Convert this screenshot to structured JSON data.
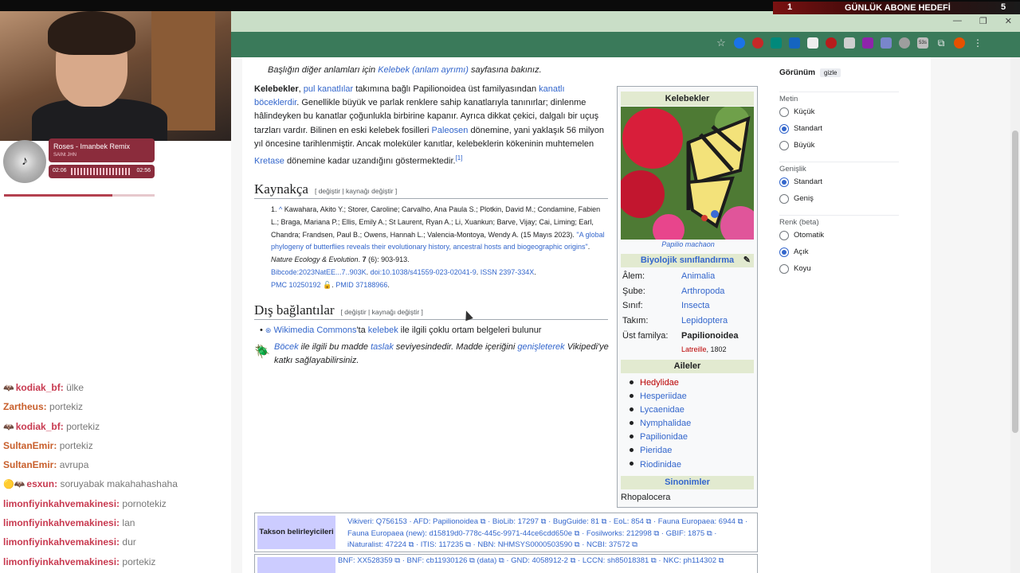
{
  "stream": {
    "sub_goal_count": "1",
    "sub_goal_label": "GÜNLÜK ABONE HEDEFİ",
    "sub_goal_target": "5",
    "music": {
      "title": "Roses - Imanbek Remix",
      "artist": "SAINt JHN",
      "time_current": "02:06",
      "time_total": "02:56",
      "progress": 0.72
    },
    "chat": [
      {
        "icon": "batman-badge",
        "user": "kodiak_bf:",
        "msg": "ülke",
        "color": "pink"
      },
      {
        "icon": "",
        "user": "Zartheus:",
        "msg": "portekiz",
        "color": "orange"
      },
      {
        "icon": "batman-badge",
        "user": "kodiak_bf:",
        "msg": "portekiz",
        "color": "pink"
      },
      {
        "icon": "",
        "user": "SultanEmir:",
        "msg": "portekiz",
        "color": "orange"
      },
      {
        "icon": "",
        "user": "SultanEmir:",
        "msg": "avrupa",
        "color": "orange"
      },
      {
        "icon": "sub-badge",
        "user": "esxun:",
        "msg": "soruyabak makahahashaha",
        "color": "pink"
      },
      {
        "icon": "",
        "user": "limonfiyinkahvemakinesi:",
        "msg": "pornotekiz",
        "color": "pink"
      },
      {
        "icon": "",
        "user": "limonfiyinkahvemakinesi:",
        "msg": "lan",
        "color": "pink"
      },
      {
        "icon": "",
        "user": "limonfiyinkahvemakinesi:",
        "msg": "dur",
        "color": "pink"
      },
      {
        "icon": "",
        "user": "limonfiyinkahvemakinesi:",
        "msg": "portekiz",
        "color": "pink"
      }
    ]
  },
  "browser": {
    "toolbar_icons": [
      "star-icon",
      "ext-icon-1",
      "ext-icon-2",
      "ext-icon-3",
      "ext-icon-4",
      "ext-icon-5",
      "ext-icon-6",
      "ext-icon-7",
      "ext-icon-8",
      "ext-icon-9",
      "ext-icon-10",
      "ext-icon-11",
      "puzzle-icon",
      "profile-icon",
      "menu-icon"
    ],
    "badge_text": "53s"
  },
  "article": {
    "hatnote_prefix": "Başlığın diğer anlamları için ",
    "hatnote_link": "Kelebek (anlam ayrımı)",
    "hatnote_suffix": " sayfasına bakınız.",
    "lead": {
      "bold": "Kelebekler",
      "t1": ", ",
      "l1": "pul kanatlılar",
      "t2": " takımına bağlı Papilionoidea üst familyasından ",
      "l2": "kanatlı böceklerdir",
      "t3": ". Genellikle büyük ve parlak renklere sahip kanatlarıyla tanınırlar; dinlenme hâlindeyken bu kanatlar çoğunlukla birbirine kapanır. Ayrıca dikkat çekici, dalgalı bir uçuş tarzları vardır. Bilinen en eski kelebek fosilleri ",
      "l3": "Paleosen",
      "t4": " dönemine, yani yaklaşık 56 milyon yıl öncesine tarihlenmiştir. Ancak moleküler kanıtlar, kelebeklerin kökeninin muhtemelen ",
      "l4": "Kretase",
      "t5": " dönemine kadar uzandığını göstermektedir.",
      "ref": "[1]"
    },
    "refs_heading": "Kaynakça",
    "refs_edit": "[ değiştir | kaynağı değiştir ]",
    "ref1": {
      "num": "1.",
      "caret": "^",
      "authors": "Kawahara, Akito Y.; Storer, Caroline; Carvalho, Ana Paula S.; Plotkin, David M.; Condamine, Fabien L.; Braga, Mariana P.; Ellis, Emily A.; St Laurent, Ryan A.; Li, Xuankun; Barve, Vijay; Cai, Liming; Earl, Chandra; Frandsen, Paul B.; Owens, Hannah L.; Valencia-Montoya, Wendy A. (15 Mayıs 2023). ",
      "title": "\"A global phylogeny of butterflies reveals their evolutionary history, ancestral hosts and biogeographic origins\"",
      "journal": "Nature Ecology & Evolution",
      "vol": "7",
      "pages": "(6): 903-913.",
      "bibcode": "Bibcode:2023NatEE...7..903K",
      "doi": "doi:10.1038/s41559-023-02041-9",
      "issn": "ISSN 2397-334X",
      "pmc": "PMC 10250192",
      "pmid": "PMID 37188966"
    },
    "ext_heading": "Dış bağlantılar",
    "ext_edit": "[ değiştir | kaynağı değiştir ]",
    "ext_item": {
      "l1": "Wikimedia Commons",
      "t1": "'ta ",
      "l2": "kelebek",
      "t2": " ile ilgili çoklu ortam belgeleri bulunur"
    },
    "stub": {
      "l1": "Böcek",
      "t1": " ile ilgili bu madde ",
      "l2": "taslak",
      "t2": " seviyesindedir. Madde içeriğini ",
      "l3": "genişleterek",
      "t3": " Vikipedi'ye katkı sağlayabilirsiniz."
    }
  },
  "infobox": {
    "title": "Kelebekler",
    "caption": "Papilio machaon",
    "classification": "Biyolojik sınıflandırma",
    "rows": [
      {
        "k": "Âlem:",
        "v": "Animalia"
      },
      {
        "k": "Şube:",
        "v": "Arthropoda"
      },
      {
        "k": "Sınıf:",
        "v": "Insecta"
      },
      {
        "k": "Takım:",
        "v": "Lepidoptera"
      },
      {
        "k": "Üst familya:",
        "v": "Papilionoidea"
      }
    ],
    "authority": "Latreille",
    "authority_year": ", 1802",
    "families_heading": "Aileler",
    "families": [
      "Hedylidae",
      "Hesperiidae",
      "Lycaenidae",
      "Nymphalidae",
      "Papilionidae",
      "Pieridae",
      "Riodinidae"
    ],
    "synonyms_heading": "Sinonimler",
    "synonym": "Rhopalocera"
  },
  "taxon": {
    "label": "Takson belirleyicileri",
    "line1": "Vikiveri: Q756153 · AFD: Papilionoidea ⧉ · BioLib: 17297 ⧉ · BugGuide: 81 ⧉ · EoL: 854 ⧉ · Fauna Europaea: 6944 ⧉ ·",
    "line2": "Fauna Europaea (new): d15819d0-778c-445c-9971-44ce6cdd650e ⧉ · Fosilworks: 212998 ⧉ · GBIF: 1875 ⧉ ·",
    "line3": "iNaturalist: 47224 ⧉ · ITIS: 117235 ⧉ · NBN: NHMSYS0000503590 ⧉ · NCBI: 37572 ⧉",
    "line4": "BNF: XX528359 ⧉ · BNF: cb11930126 ⧉ (data) ⧉ · GND: 4058912-2 ⧉ · LCCN: sh85018381 ⧉ · NKC: ph114302 ⧉"
  },
  "appearance": {
    "title": "Görünüm",
    "hide": "gizle",
    "text_label": "Metin",
    "text_opts": [
      "Küçük",
      "Standart",
      "Büyük"
    ],
    "text_selected": 1,
    "width_label": "Genişlik",
    "width_opts": [
      "Standart",
      "Geniş"
    ],
    "width_selected": 0,
    "color_label": "Renk (beta)",
    "color_opts": [
      "Otomatik",
      "Açık",
      "Koyu"
    ],
    "color_selected": 1
  },
  "colors": {
    "link": "#3366cc",
    "infobox_header": "#e2ead0",
    "taxon_label": "#ccccff",
    "red_link": "#ba0000"
  }
}
